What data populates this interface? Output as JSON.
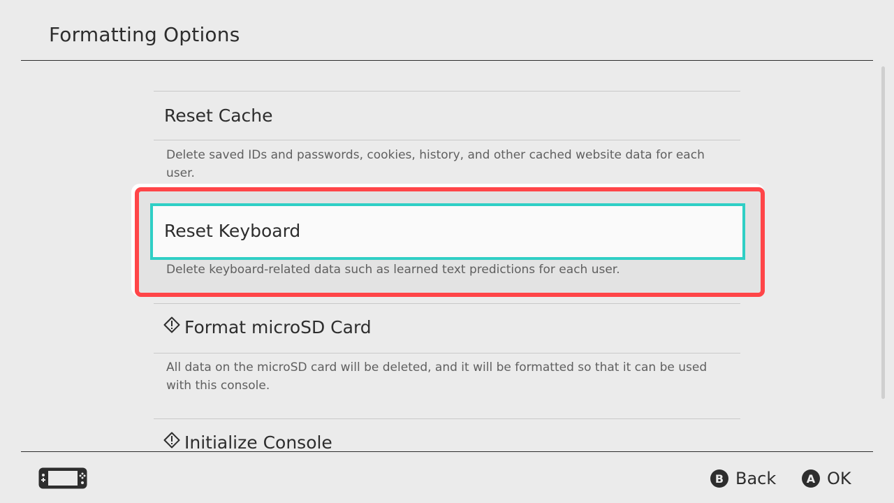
{
  "header": {
    "title": "Formatting Options"
  },
  "items": [
    {
      "title": "Reset Cache",
      "description": "Delete saved IDs and passwords, cookies, history, and other cached website data for each user.",
      "warning": false
    },
    {
      "title": "Reset Keyboard",
      "description": "Delete keyboard-related data such as learned text predictions for each user.",
      "warning": false,
      "selected": true
    },
    {
      "title": "Format microSD Card",
      "description": "All data on the microSD card will be deleted, and it will be formatted so that it can be used with this console.",
      "warning": true,
      "icon": "warning-diamond-icon"
    },
    {
      "title": "Initialize Console",
      "warning": true,
      "icon": "warning-diamond-icon"
    }
  ],
  "footer": {
    "console_icon": "handheld-console-icon",
    "back": {
      "glyph": "B",
      "label": "Back"
    },
    "ok": {
      "glyph": "A",
      "label": "OK"
    }
  },
  "colors": {
    "background": "#ebebeb",
    "selection_border": "#2fcfc5",
    "highlight_annotation": "#ff4548"
  }
}
